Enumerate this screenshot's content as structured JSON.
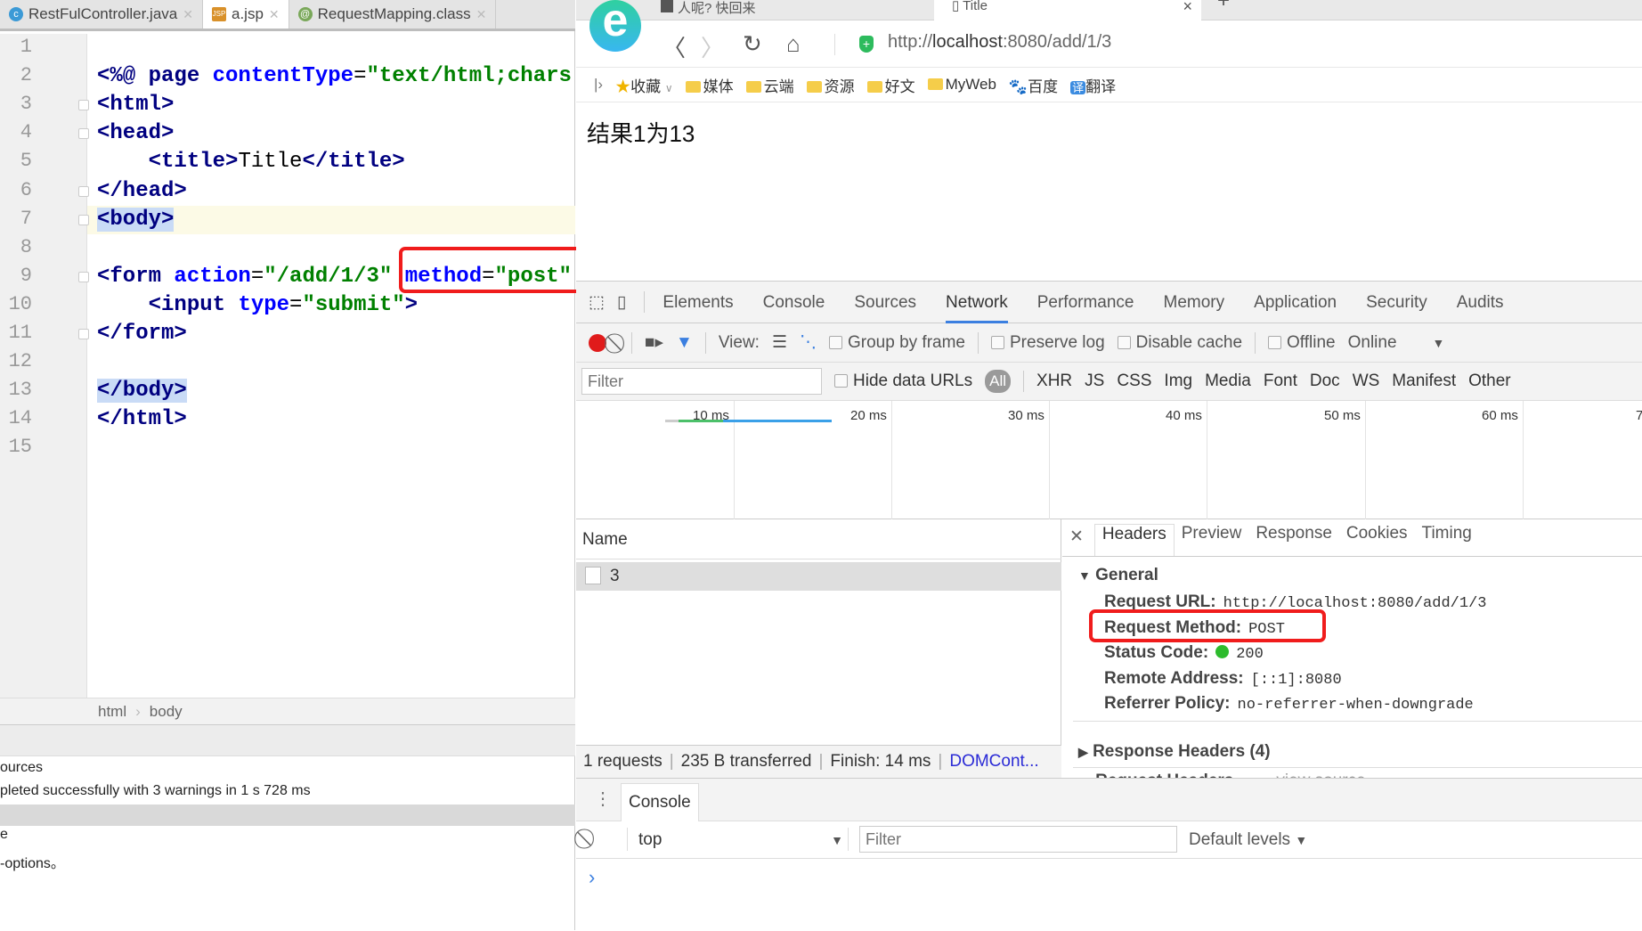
{
  "ide": {
    "tabs": [
      {
        "label": "RestFulController.java",
        "icon": "class-icon",
        "active": false
      },
      {
        "label": "a.jsp",
        "icon": "jsp-file-icon",
        "active": true
      },
      {
        "label": "RequestMapping.class",
        "icon": "annotation-icon",
        "active": false
      }
    ],
    "code_lines": [
      [],
      [
        [
          "<%@ ",
          "tag"
        ],
        [
          "page ",
          "tag"
        ],
        [
          "contentType",
          "attr"
        ],
        [
          "=",
          "txt"
        ],
        [
          "\"text/html;chars",
          "str"
        ]
      ],
      [
        [
          "<html>",
          "tag"
        ]
      ],
      [
        [
          "<head>",
          "tag"
        ]
      ],
      [
        [
          "    ",
          "txt"
        ],
        [
          "<title>",
          "tag"
        ],
        [
          "Title",
          "txt"
        ],
        [
          "</title>",
          "tag"
        ]
      ],
      [
        [
          "</head>",
          "tag"
        ]
      ],
      [
        [
          "<body>",
          "tag sel"
        ]
      ],
      [],
      [
        [
          "<form ",
          "tag"
        ],
        [
          "action",
          "attr"
        ],
        [
          "=",
          "txt"
        ],
        [
          "\"/add/1/3\"",
          "str"
        ],
        [
          " ",
          "txt"
        ],
        [
          "method",
          "attr"
        ],
        [
          "=",
          "txt"
        ],
        [
          "\"post\"",
          "str"
        ]
      ],
      [
        [
          "    ",
          "txt"
        ],
        [
          "<input ",
          "tag"
        ],
        [
          "type",
          "attr"
        ],
        [
          "=",
          "txt"
        ],
        [
          "\"submit\"",
          "str"
        ],
        [
          ">",
          "tag"
        ]
      ],
      [
        [
          "</form>",
          "tag"
        ]
      ],
      [],
      [
        [
          "</body>",
          "tag sel"
        ]
      ],
      [
        [
          "</html>",
          "tag"
        ]
      ],
      []
    ],
    "breadcrumb": [
      "html",
      "body"
    ],
    "build_output": [
      "ources",
      "pleted successfully with 3 warnings in 1 s 728 ms",
      "",
      "e",
      "-options。"
    ]
  },
  "browser": {
    "tabs": [
      {
        "label": "人呢? 快回来"
      },
      {
        "label": "Title"
      }
    ],
    "new_tab": "+",
    "close_tab": "×",
    "url_prefix": "http://",
    "url_host": "localhost",
    "url_rest": ":8080/add/1/3",
    "bookmarks": [
      "收藏",
      "媒体",
      "云端",
      "资源",
      "好文",
      "MyWeb",
      "百度",
      "翻译"
    ],
    "page_text": "结果1为13"
  },
  "devtools": {
    "tabs": [
      "Elements",
      "Console",
      "Sources",
      "Network",
      "Performance",
      "Memory",
      "Application",
      "Security",
      "Audits"
    ],
    "active_tab": "Network",
    "toolbar": {
      "view_label": "View:",
      "group_by_frame": "Group by frame",
      "preserve_log": "Preserve log",
      "disable_cache": "Disable cache",
      "offline": "Offline",
      "throttle": "Online"
    },
    "filter_placeholder": "Filter",
    "hide_data_urls": "Hide data URLs",
    "types": [
      "All",
      "XHR",
      "JS",
      "CSS",
      "Img",
      "Media",
      "Font",
      "Doc",
      "WS",
      "Manifest",
      "Other"
    ],
    "timeline_ticks": [
      "10 ms",
      "20 ms",
      "30 ms",
      "40 ms",
      "50 ms",
      "60 ms",
      "7"
    ],
    "name_header": "Name",
    "requests": [
      {
        "name": "3"
      }
    ],
    "status": {
      "requests": "1 requests",
      "transferred": "235 B transferred",
      "finish": "Finish: 14 ms",
      "domcontent": "DOMCont..."
    },
    "detail_tabs": [
      "Headers",
      "Preview",
      "Response",
      "Cookies",
      "Timing"
    ],
    "general_label": "General",
    "general": [
      {
        "key": "Request URL:",
        "value": "http://localhost:8080/add/1/3"
      },
      {
        "key": "Request Method:",
        "value": "POST"
      },
      {
        "key": "Status Code:",
        "value": "200"
      },
      {
        "key": "Remote Address:",
        "value": "[::1]:8080"
      },
      {
        "key": "Referrer Policy:",
        "value": "no-referrer-when-downgrade"
      }
    ],
    "response_headers": "Response Headers (4)",
    "request_headers": "Request Headers",
    "view_source": "view source",
    "drawer": {
      "tab": "Console",
      "context": "top",
      "filter_placeholder": "Filter",
      "levels": "Default levels",
      "prompt": "›"
    }
  },
  "colors": {
    "highlight_box": "#f01c1c",
    "active_tab_underline": "#3b7fe0",
    "status_ok": "#2dbb2d",
    "record": "#e01b1b"
  }
}
